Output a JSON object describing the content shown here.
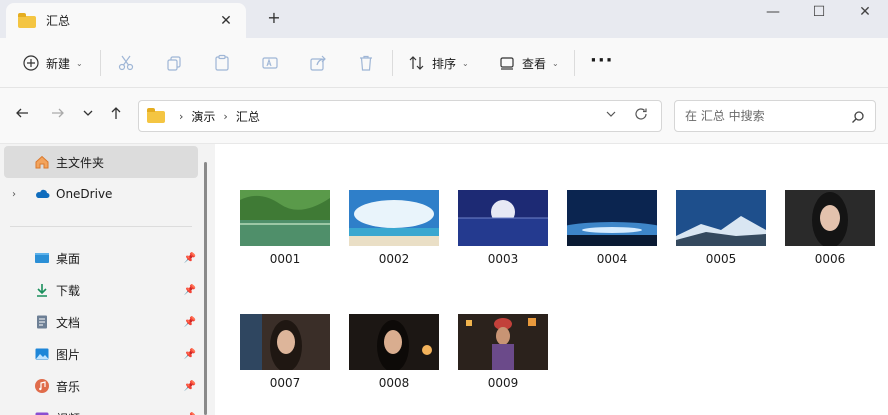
{
  "tabbar": {
    "tab_title": "汇总",
    "close_glyph": "✕",
    "new_tab_glyph": "+",
    "window_controls": [
      "—",
      "☐",
      "✕"
    ]
  },
  "commandbar": {
    "new_label": "新建",
    "sort_label": "排序",
    "view_label": "查看",
    "more_glyph": "···"
  },
  "address": {
    "crumbs": [
      "演示",
      "汇总"
    ],
    "search_placeholder": "在 汇总 中搜索"
  },
  "sidebar": {
    "home": "主文件夹",
    "onedrive": "OneDrive",
    "quick_access": [
      {
        "label": "桌面",
        "icon": "desktop-icon"
      },
      {
        "label": "下载",
        "icon": "download-icon"
      },
      {
        "label": "文档",
        "icon": "documents-icon"
      },
      {
        "label": "图片",
        "icon": "pictures-icon"
      },
      {
        "label": "音乐",
        "icon": "music-icon"
      },
      {
        "label": "视频",
        "icon": "videos-icon"
      }
    ]
  },
  "files": [
    {
      "name": "0001",
      "scene": "lake-forest"
    },
    {
      "name": "0002",
      "scene": "beach-sky"
    },
    {
      "name": "0003",
      "scene": "moon-sea"
    },
    {
      "name": "0004",
      "scene": "earth-horizon"
    },
    {
      "name": "0005",
      "scene": "snow-mountain"
    },
    {
      "name": "0006",
      "scene": "portrait-dark"
    },
    {
      "name": "0007",
      "scene": "portrait-window"
    },
    {
      "name": "0008",
      "scene": "portrait-night"
    },
    {
      "name": "0009",
      "scene": "street-night"
    }
  ],
  "colors": {
    "folder": "#f4c542",
    "accent": "#0067c0"
  }
}
